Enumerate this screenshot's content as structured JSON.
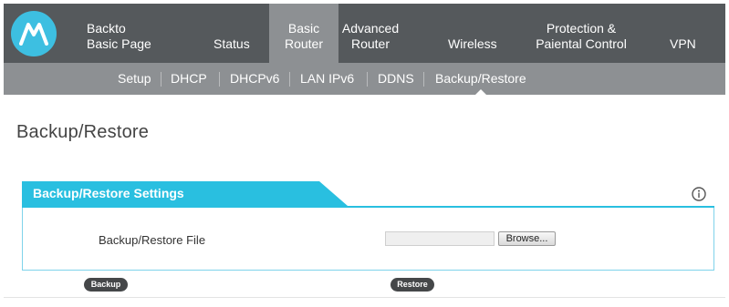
{
  "brand": {
    "logo_icon": "motorola-m-icon",
    "logo_color": "#3dbfe1"
  },
  "nav": {
    "items": [
      {
        "lines": [
          "Backto",
          "Basic Page"
        ]
      },
      {
        "lines": [
          "Status"
        ]
      },
      {
        "lines": [
          "Basic",
          "Router"
        ],
        "active": true
      },
      {
        "lines": [
          "Advanced",
          "Router"
        ]
      },
      {
        "lines": [
          "Wireless"
        ]
      },
      {
        "lines": [
          "Protection &",
          "Paiental Control"
        ]
      },
      {
        "lines": [
          "VPN"
        ]
      }
    ]
  },
  "subnav": {
    "items": [
      "Setup",
      "DHCP",
      "DHCPv6",
      "LAN IPv6",
      "DDNS",
      "Backup/Restore"
    ],
    "active": "Backup/Restore"
  },
  "page": {
    "title": "Backup/Restore"
  },
  "panel": {
    "title": "Backup/Restore Settings",
    "info_icon": "info-circle-icon",
    "file_label": "Backup/Restore File",
    "file_value": "",
    "browse_label": "Browse..."
  },
  "buttons": {
    "backup": "Backup",
    "restore": "Restore"
  },
  "colors": {
    "nav_bg": "#55595c",
    "subnav_bg": "#8d9093",
    "accent": "#29bfe0",
    "button_bg": "#454749"
  }
}
